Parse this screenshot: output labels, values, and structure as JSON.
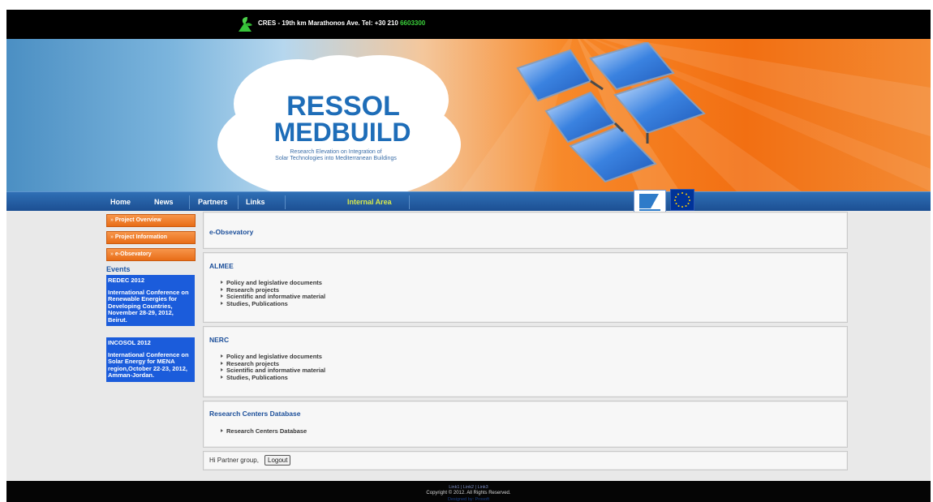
{
  "header": {
    "contact_text": "CRES - 19th km Marathonos Ave. Tel: +30 210 ",
    "contact_phone_highlight": "6603300"
  },
  "banner": {
    "brand_line1": "RESSOL",
    "brand_line2": "MEDBUILD",
    "tagline_line1": "Research Elevation on Integration of",
    "tagline_line2": "Solar Technologies into Mediterranean Buildings"
  },
  "nav": {
    "items": [
      {
        "label": "Home"
      },
      {
        "label": "News"
      },
      {
        "label": "Partners"
      },
      {
        "label": "Links"
      },
      {
        "label": "Internal Area"
      }
    ]
  },
  "sidebar": {
    "buttons": [
      {
        "label": "Project Overview"
      },
      {
        "label": "Project Information"
      },
      {
        "label": "e-Obsevatory"
      }
    ],
    "events_title": "Events",
    "events": [
      {
        "title": "REDEC 2012",
        "body": "International Conference on Renewable Energies for Developing Countries, November 28-29, 2012, Beirut."
      },
      {
        "title": "INCOSOL 2012",
        "body": "International Conference on Solar Energy for MENA region,October 22-23, 2012, Amman-Jordan."
      }
    ]
  },
  "main": {
    "obs_title": "e-Obsevatory",
    "almee": {
      "title": "ALMEE",
      "items": [
        "Policy and legislative documents",
        "Research projects",
        "Scientific and informative material",
        "Studies, Publications"
      ]
    },
    "nerc": {
      "title": "NERC",
      "items": [
        "Policy and legislative documents",
        "Research projects",
        "Scientific and informative material",
        "Studies, Publications"
      ]
    },
    "rcd": {
      "title": "Research Centers Database",
      "items": [
        "Research Centers Database"
      ]
    },
    "greeting": "Hi Partner group,",
    "logout_label": "Logout"
  },
  "footer": {
    "link1": "Link1",
    "link2": "Link2",
    "link3": "Link3",
    "separator": " | ",
    "copyright": "Copyright © 2012. All Rights Reserved.",
    "designed_by": "Designed by: Prosoft"
  },
  "colors": {
    "accent_orange": "#f26f12",
    "nav_blue": "#1c4f93",
    "event_blue": "#1b5cdb",
    "title_blue": "#1c4f9a"
  }
}
